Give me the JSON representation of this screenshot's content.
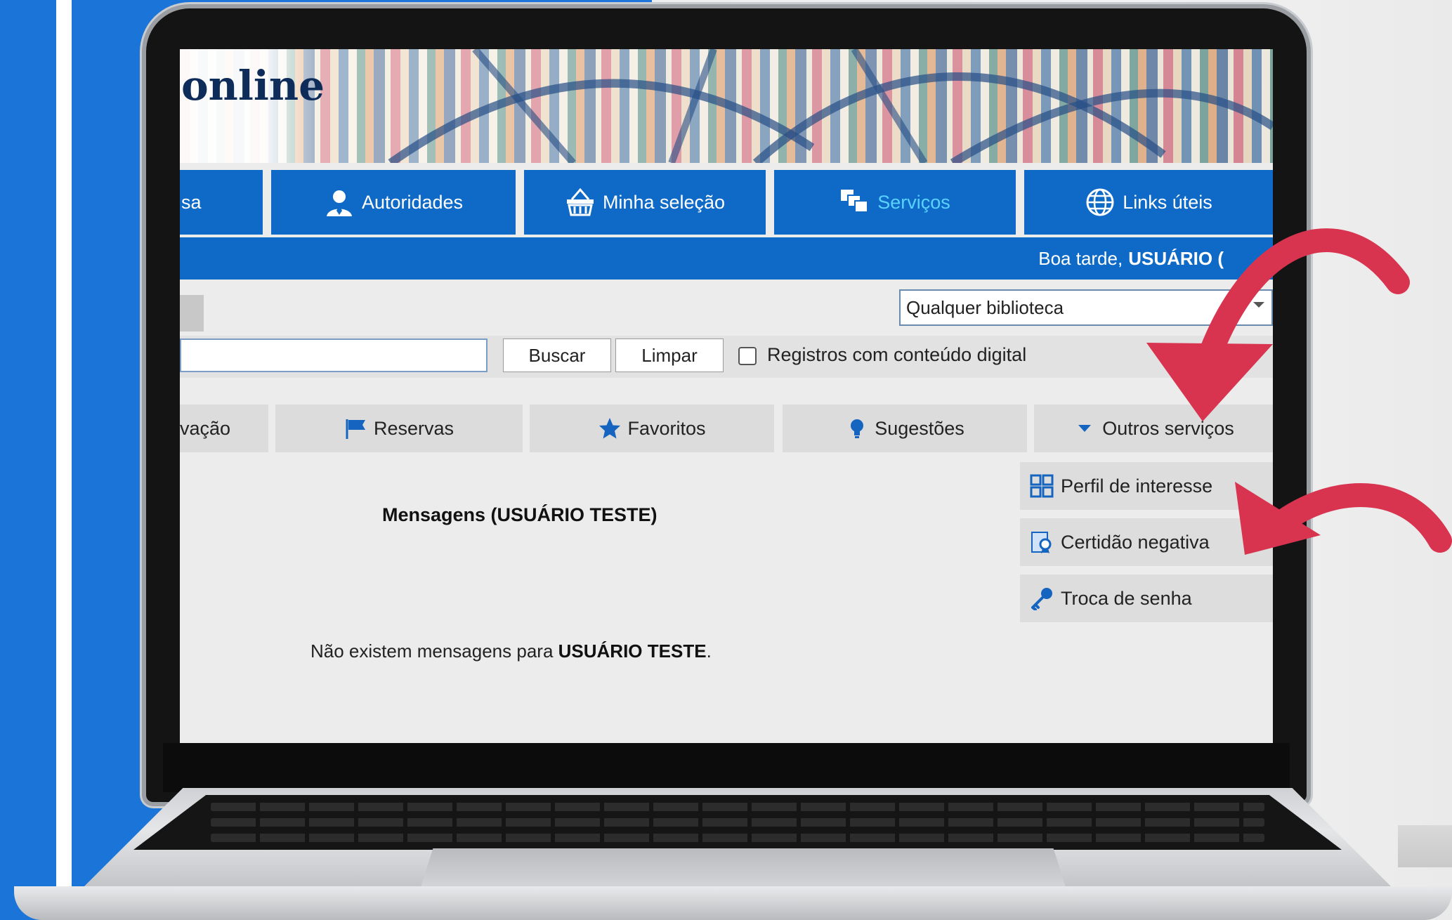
{
  "app": {
    "logo_text": "online"
  },
  "nav": {
    "items": [
      {
        "label": "sa",
        "icon": "search-icon"
      },
      {
        "label": "Autoridades",
        "icon": "person-icon"
      },
      {
        "label": "Minha seleção",
        "icon": "basket-icon"
      },
      {
        "label": "Serviços",
        "icon": "services-icon",
        "active": true
      },
      {
        "label": "Links úteis",
        "icon": "globe-icon"
      }
    ]
  },
  "greeting": {
    "prefix": "Boa tarde,",
    "user": "USUÁRIO (",
    "bar_color": "#0e6ac6"
  },
  "library_select": {
    "value": "Qualquer biblioteca"
  },
  "search": {
    "value": "",
    "buttons": {
      "search": "Buscar",
      "clear": "Limpar"
    },
    "digital_checkbox_label": "Registros com conteúdo digital"
  },
  "subtabs": [
    {
      "label": "vação"
    },
    {
      "label": "Reservas",
      "icon": "flag-icon"
    },
    {
      "label": "Favoritos",
      "icon": "star-icon"
    },
    {
      "label": "Sugestões",
      "icon": "lightbulb-icon"
    },
    {
      "label": "Outros serviços",
      "icon": "caret-down-icon"
    }
  ],
  "other_services_menu": [
    {
      "label": "Perfil de interesse",
      "icon": "grid-icon"
    },
    {
      "label": "Certidão negativa",
      "icon": "certificate-icon"
    },
    {
      "label": "Troca de senha",
      "icon": "key-icon"
    }
  ],
  "messages": {
    "title": "Mensagens (USUÁRIO TESTE)",
    "empty_prefix": "Não existem mensagens para",
    "empty_user": "USUÁRIO TESTE",
    "empty_suffix": "."
  },
  "colors": {
    "brand_blue": "#0e6ac6",
    "background_blue": "#1b74d8",
    "active_nav_text": "#5ad2ff",
    "annotation_arrow": "#d8344f"
  }
}
